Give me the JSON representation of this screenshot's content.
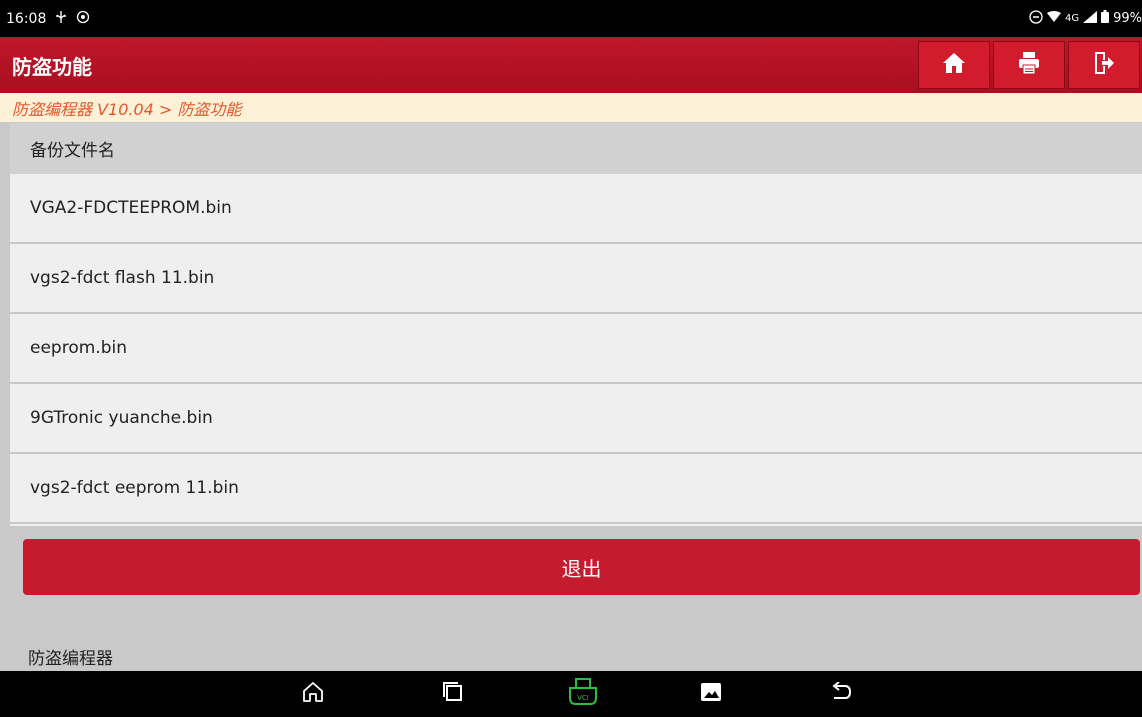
{
  "status_bar": {
    "time": "16:08",
    "left_icons": [
      "usb-icon",
      "settings-cog-icon"
    ],
    "network": "4G",
    "battery": "99%"
  },
  "header": {
    "title": "防盗功能",
    "buttons": [
      "home-icon",
      "print-icon",
      "exit-icon"
    ]
  },
  "breadcrumb": "防盗编程器 V10.04 > 防盗功能",
  "list": {
    "header": "备份文件名",
    "items": [
      "VGA2-FDCTEEPROM.bin",
      "vgs2-fdct flash 11.bin",
      "eeprom.bin",
      "9GTronic yuanche.bin",
      "vgs2-fdct eeprom 11.bin"
    ]
  },
  "exit_button": "退出",
  "footer_label": "防盗编程器",
  "nav_bar": {
    "icons": [
      "home-icon",
      "recent-apps-icon",
      "vci-icon",
      "gallery-icon",
      "back-icon"
    ],
    "vci_label": "VCI"
  },
  "colors": {
    "header_red": "#c0162a",
    "breadcrumb_text": "#e8562a",
    "breadcrumb_bg": "#fdf2d7",
    "vci_green": "#2bbd3e"
  }
}
